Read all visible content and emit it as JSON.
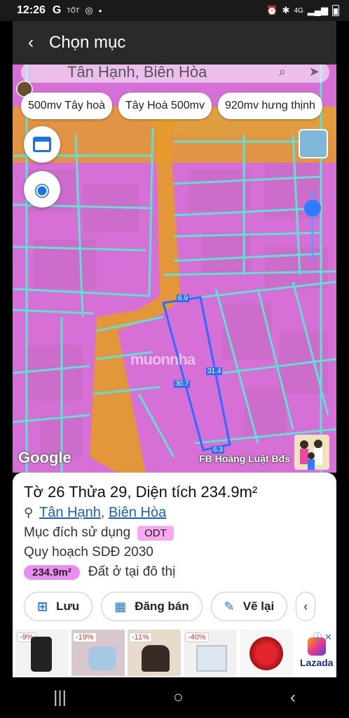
{
  "status_bar": {
    "time": "12:26",
    "left_icons": [
      "G",
      "TỐT",
      "◎",
      "•"
    ],
    "network": "4G"
  },
  "title_bar": {
    "back_glyph": "‹",
    "title": "Chọn mục"
  },
  "search": {
    "value": "Tân Hạnh, Biên Hòa"
  },
  "chips": [
    "500mv Tây hoà",
    "Tây Hoà 500mv",
    "920mv hưng thịnh"
  ],
  "map": {
    "plot_labels": {
      "top": "6.9",
      "left": "30.7",
      "right": "31.4",
      "bottom": "6.3"
    },
    "google_logo": "Google",
    "credit": "FB Hoàng Luật Bđs",
    "watermark": "muonnha",
    "colors": {
      "residential": "#d66fd6",
      "road": "#e59a2a",
      "boundary": "#5fe0d3",
      "plot_outline": "#2f6bff"
    }
  },
  "parcel": {
    "heading": "Tờ 26 Thửa 29, Diện tích 234.9m²",
    "ward": "Tân Hạnh",
    "separator": ", ",
    "city": "Biên Hòa",
    "usage_label": "Mục đích sử dụng",
    "usage_code": "ODT",
    "plan_label": "Quy hoạch SDĐ 2030",
    "area_pill": "234.9m²",
    "area_desc": "Đất ở tại đô thị"
  },
  "actions": [
    {
      "label": "Lưu",
      "icon": "add-square-icon"
    },
    {
      "label": "Đăng bán",
      "icon": "calendar-icon"
    },
    {
      "label": "Vẽ lại",
      "icon": "edit-icon"
    }
  ],
  "ads": {
    "discounts": [
      "-9%",
      "-19%",
      "-11%",
      "-40%"
    ],
    "brand": "Lazada",
    "close": "ⓘ ✕"
  },
  "nav": {
    "recent": "|||",
    "home": "○",
    "back": "‹"
  }
}
